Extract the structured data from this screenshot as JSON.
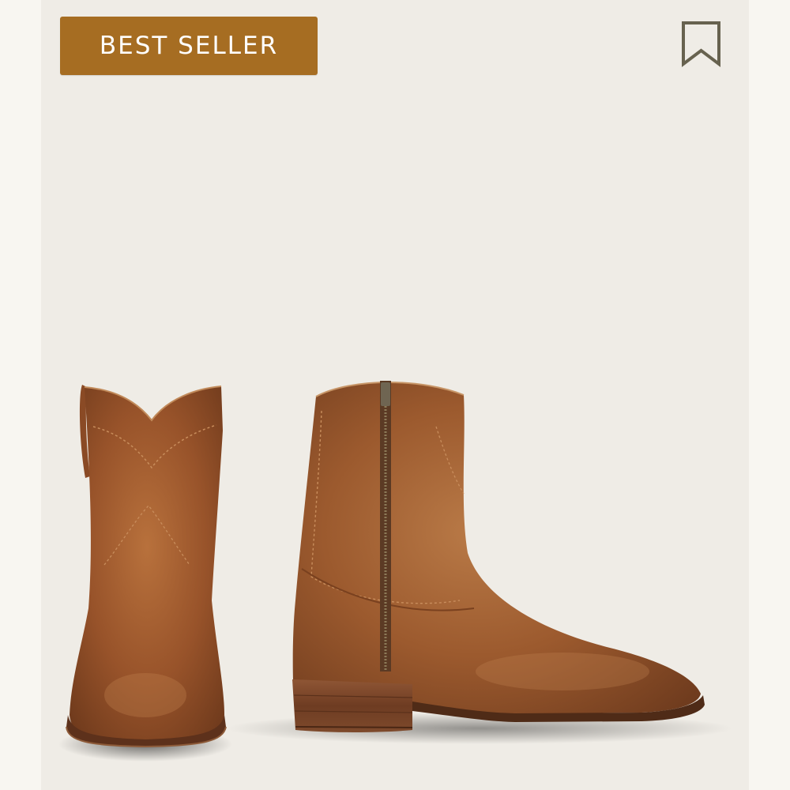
{
  "badge": {
    "label": "BEST SELLER",
    "color": "#a66d22"
  },
  "bookmark": {
    "icon": "bookmark-icon"
  },
  "product": {
    "image": "pair-of-brown-leather-zip-ankle-boots"
  },
  "colors": {
    "card_background": "#efece6",
    "page_background": "#f8f6f1",
    "leather": "#9a5428"
  }
}
